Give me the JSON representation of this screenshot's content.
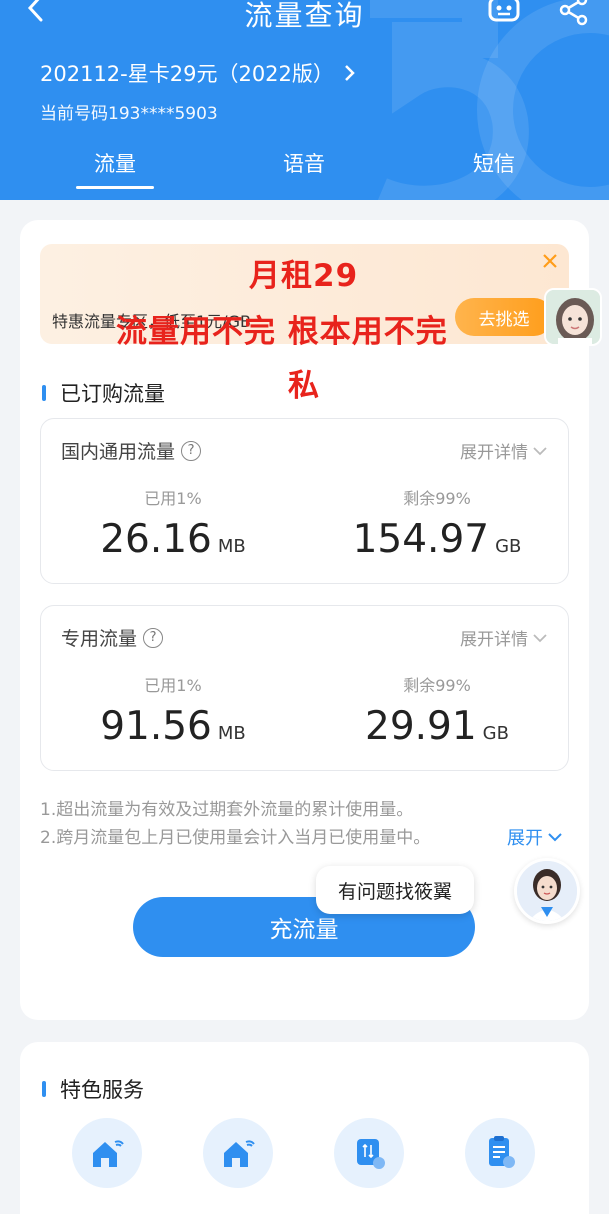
{
  "header": {
    "title": "流量查询",
    "plan_name": "202112-星卡29元（2022版）",
    "phone_line": "当前号码193****5903",
    "tabs": [
      "流量",
      "语音",
      "短信"
    ],
    "active_tab": 0
  },
  "promo": {
    "text": "特惠流量专区，低至1元/GB",
    "button": "去挑选"
  },
  "overlay_text": {
    "line1": "月租29",
    "line2": "流量用不完 根本用不完",
    "line3": "私"
  },
  "subscribed": {
    "title": "已订购流量",
    "boxes": [
      {
        "title": "国内通用流量",
        "expand": "展开详情",
        "used_label": "已用1%",
        "used_value": "26.16",
        "used_unit": "MB",
        "remain_label": "剩余99%",
        "remain_value": "154.97",
        "remain_unit": "GB"
      },
      {
        "title": "专用流量",
        "expand": "展开详情",
        "used_label": "已用1%",
        "used_value": "91.56",
        "used_unit": "MB",
        "remain_label": "剩余99%",
        "remain_value": "29.91",
        "remain_unit": "GB"
      }
    ]
  },
  "notes": {
    "line1": "1.超出流量为有效及过期套外流量的累计使用量。",
    "line2": "2.跨月流量包上月已使用量会计入当月已使用量中。",
    "expand": "展开"
  },
  "recharge_button": "充流量",
  "assistant_tip": "有问题找筱翼",
  "services": {
    "title": "特色服务",
    "icons": [
      "home-wifi-icon",
      "home-wifi-icon",
      "traffic-card-icon",
      "traffic-bill-icon"
    ]
  },
  "colors": {
    "primary": "#2f8ff0",
    "overlay_red": "#e8231c",
    "promo_orange": "#ff9d1a"
  }
}
